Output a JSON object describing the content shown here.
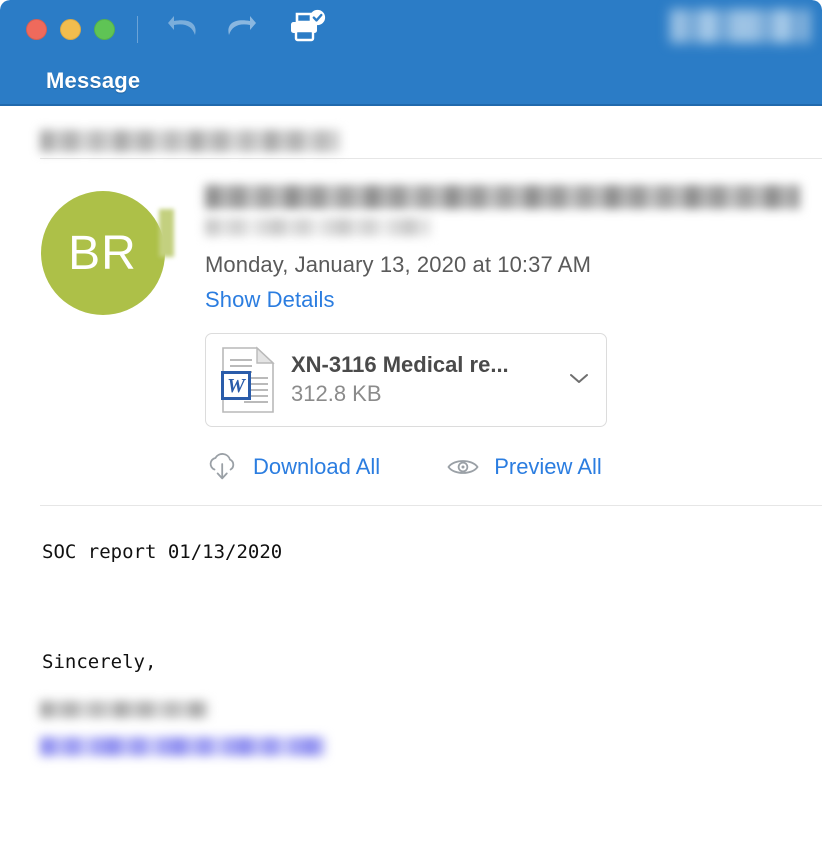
{
  "window": {
    "traffic_lights": [
      {
        "name": "close",
        "color": "#ef6a5c"
      },
      {
        "name": "minimize",
        "color": "#f2bd4e"
      },
      {
        "name": "zoom",
        "color": "#5fc455"
      }
    ],
    "titlebar_color": "#2b7cc6"
  },
  "toolbar": {
    "undo_label": "Undo",
    "redo_label": "Redo",
    "print_label": "Print",
    "redacted_control": ""
  },
  "header": {
    "title": "Message"
  },
  "subject": {
    "redacted": ""
  },
  "sender": {
    "avatar_initials": "BR",
    "avatar_color": "#adc048",
    "name_redacted": "",
    "address_redacted": "",
    "date": "Monday, January 13, 2020 at 10:37 AM",
    "show_details_label": "Show Details"
  },
  "attachment": {
    "file_name": "XN-3116 Medical re...",
    "file_size": "312.8 KB",
    "file_type": "word-document",
    "expand_label": ""
  },
  "actions": {
    "download_all_label": "Download All",
    "preview_all_label": "Preview All",
    "link_color": "#2b7de0"
  },
  "body": {
    "line1": "SOC report 01/13/2020",
    "line2": "Sincerely,",
    "signature_name_redacted": "",
    "signature_link_redacted": ""
  }
}
